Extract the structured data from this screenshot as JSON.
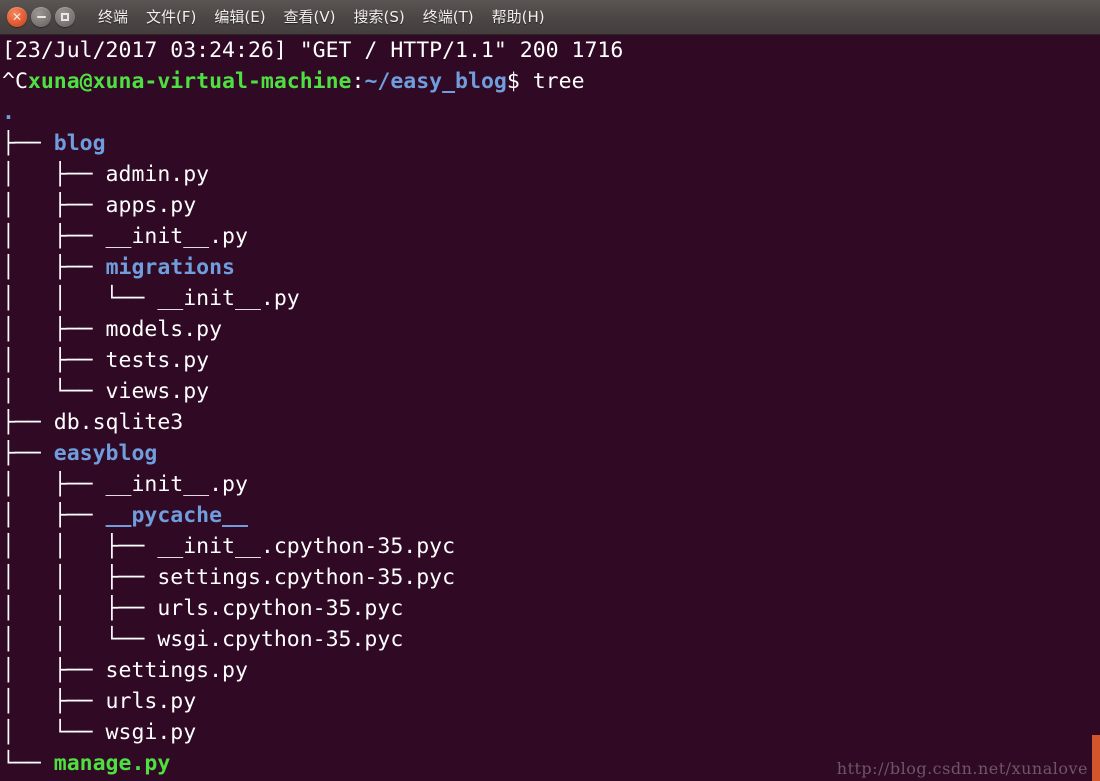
{
  "window": {
    "controls": [
      {
        "name": "close",
        "glyph": "✕"
      },
      {
        "name": "minimize",
        "glyph": "–"
      },
      {
        "name": "maximize",
        "glyph": "□"
      }
    ],
    "menu": [
      "终端",
      "文件(F)",
      "编辑(E)",
      "查看(V)",
      "搜索(S)",
      "终端(T)",
      "帮助(H)"
    ]
  },
  "colors": {
    "background": "#300a24",
    "titlebar": "#4b4644",
    "foreground": "#ffffff",
    "prompt_user": "#4ee040",
    "prompt_path": "#709ddd",
    "directory": "#709ddd",
    "executable": "#4ee040",
    "scrollbar": "#d2562c",
    "watermark": "#7a6472"
  },
  "terminal": {
    "lines": [
      {
        "segments": [
          {
            "text": "[23/Jul/2017 03:24:26] \"GET / HTTP/1.1\" 200 1716",
            "color": "white"
          }
        ]
      },
      {
        "segments": [
          {
            "text": "^C",
            "color": "white"
          },
          {
            "text": "xuna@xuna-virtual-machine",
            "color": "green"
          },
          {
            "text": ":",
            "color": "white"
          },
          {
            "text": "~/easy_blog",
            "color": "blue"
          },
          {
            "text": "$ tree",
            "color": "white"
          }
        ]
      },
      {
        "segments": [
          {
            "text": ".",
            "color": "blue"
          }
        ]
      },
      {
        "segments": [
          {
            "text": "├── ",
            "color": "tree"
          },
          {
            "text": "blog",
            "color": "blue"
          }
        ]
      },
      {
        "segments": [
          {
            "text": "│   ├── admin.py",
            "color": "white"
          }
        ]
      },
      {
        "segments": [
          {
            "text": "│   ├── apps.py",
            "color": "white"
          }
        ]
      },
      {
        "segments": [
          {
            "text": "│   ├── __init__.py",
            "color": "white"
          }
        ]
      },
      {
        "segments": [
          {
            "text": "│   ├── ",
            "color": "tree"
          },
          {
            "text": "migrations",
            "color": "blue"
          }
        ]
      },
      {
        "segments": [
          {
            "text": "│   │   └── __init__.py",
            "color": "white"
          }
        ]
      },
      {
        "segments": [
          {
            "text": "│   ├── models.py",
            "color": "white"
          }
        ]
      },
      {
        "segments": [
          {
            "text": "│   ├── tests.py",
            "color": "white"
          }
        ]
      },
      {
        "segments": [
          {
            "text": "│   └── views.py",
            "color": "white"
          }
        ]
      },
      {
        "segments": [
          {
            "text": "├── db.sqlite3",
            "color": "white"
          }
        ]
      },
      {
        "segments": [
          {
            "text": "├── ",
            "color": "tree"
          },
          {
            "text": "easyblog",
            "color": "blue"
          }
        ]
      },
      {
        "segments": [
          {
            "text": "│   ├── __init__.py",
            "color": "white"
          }
        ]
      },
      {
        "segments": [
          {
            "text": "│   ├── ",
            "color": "tree"
          },
          {
            "text": "__pycache__",
            "color": "blue"
          }
        ]
      },
      {
        "segments": [
          {
            "text": "│   │   ├── __init__.cpython-35.pyc",
            "color": "white"
          }
        ]
      },
      {
        "segments": [
          {
            "text": "│   │   ├── settings.cpython-35.pyc",
            "color": "white"
          }
        ]
      },
      {
        "segments": [
          {
            "text": "│   │   ├── urls.cpython-35.pyc",
            "color": "white"
          }
        ]
      },
      {
        "segments": [
          {
            "text": "│   │   └── wsgi.cpython-35.pyc",
            "color": "white"
          }
        ]
      },
      {
        "segments": [
          {
            "text": "│   ├── settings.py",
            "color": "white"
          }
        ]
      },
      {
        "segments": [
          {
            "text": "│   ├── urls.py",
            "color": "white"
          }
        ]
      },
      {
        "segments": [
          {
            "text": "│   └── wsgi.py",
            "color": "white"
          }
        ]
      },
      {
        "segments": [
          {
            "text": "└── ",
            "color": "tree"
          },
          {
            "text": "manage.py",
            "color": "green"
          }
        ]
      }
    ]
  },
  "watermark": {
    "text": "http://blog.csdn.net/xunalove"
  }
}
